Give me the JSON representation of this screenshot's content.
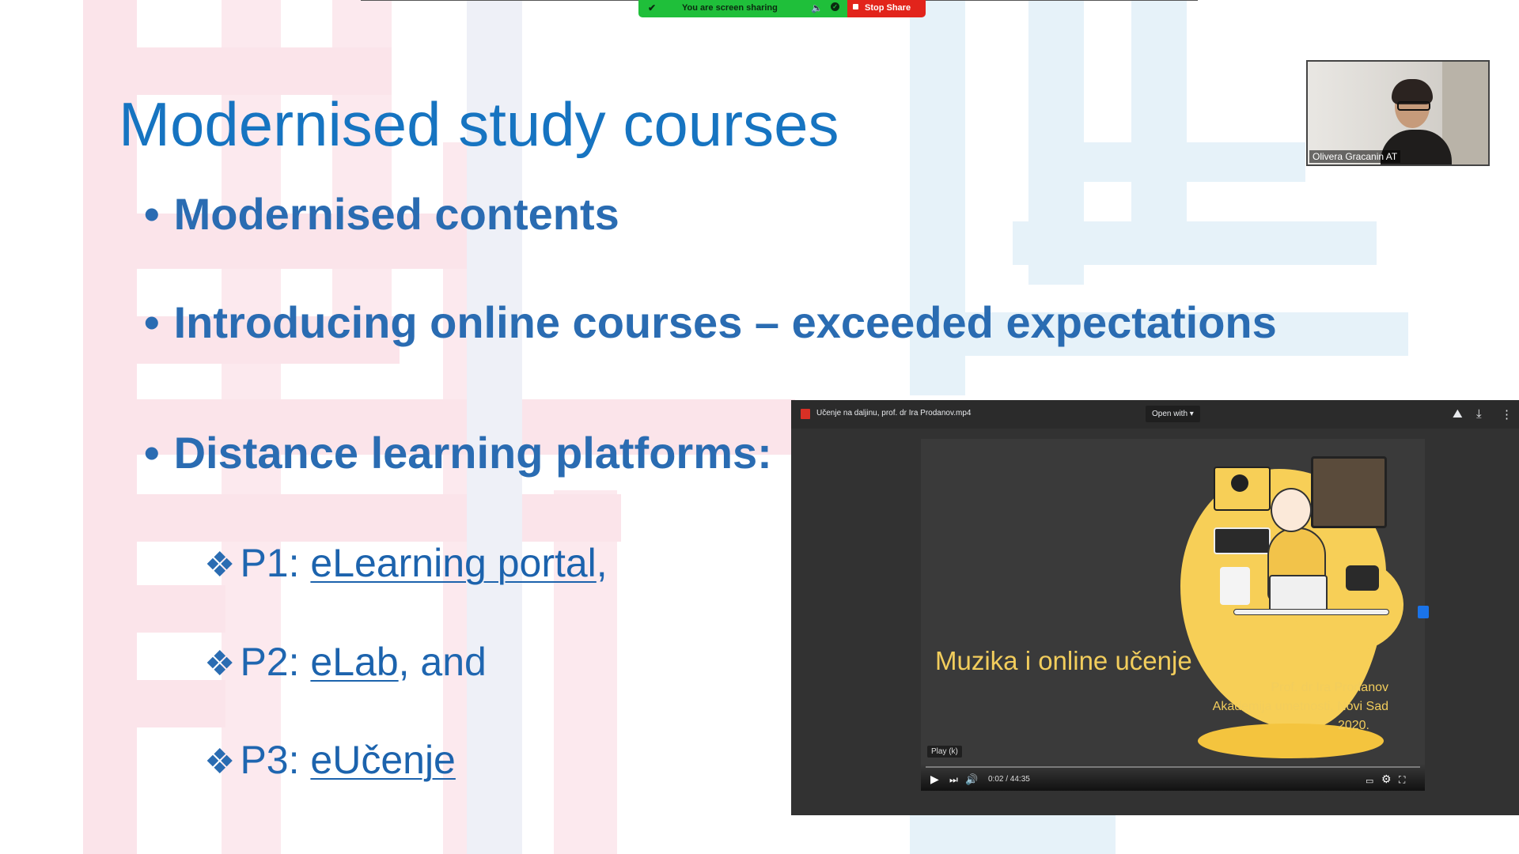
{
  "screen_share": {
    "status_text": "You are screen sharing",
    "stop_label": "Stop Share",
    "colors": {
      "green": "#1fbf3a",
      "red": "#e2241b"
    }
  },
  "participant": {
    "name": "Olivera Gracanin AT"
  },
  "slide": {
    "title": "Modernised study courses",
    "bullets": [
      "Modernised contents",
      "Introducing online courses – exceeded expectations",
      "Distance learning platforms:"
    ],
    "platforms": [
      {
        "prefix": "P1: ",
        "link": "eLearning portal",
        "suffix": ","
      },
      {
        "prefix": "P2: ",
        "link": "eLab",
        "suffix": ", and"
      },
      {
        "prefix": "P3: ",
        "link": "eUčenje",
        "suffix": ""
      }
    ],
    "colors": {
      "title": "#1674c1",
      "bullets": "#2a6cb2",
      "links": "#1c63ad"
    }
  },
  "viewer": {
    "file_name": "Učenje na daljinu, prof. dr Ira Prodanov.mp4",
    "open_with_label": "Open with ▾",
    "video": {
      "title": "Muzika i online učenje",
      "credits": [
        "Prof. dr Ira Prodanov",
        "Akademija umetnosti, Novi Sad",
        "2020."
      ],
      "play_hint": "Play (k)",
      "time": "0:02 / 44:35"
    }
  }
}
